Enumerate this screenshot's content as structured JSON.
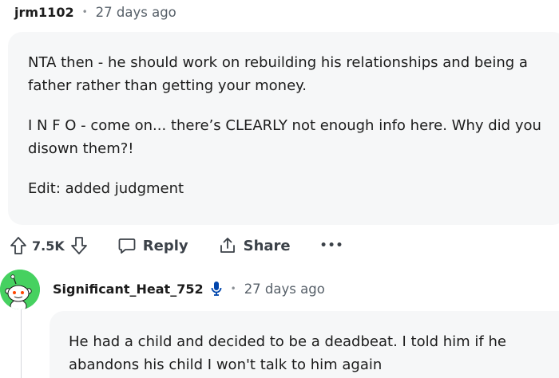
{
  "comment1": {
    "author": "jrm1102",
    "separator": "•",
    "time": "27 days ago",
    "paragraphs": [
      "NTA then - he should work on rebuilding his relationships and being a\nfather rather than getting your money.",
      "I N F O - come on... there’s CLEARLY not enough info here. Why did you\ndisown them?!",
      "Edit: added judgment"
    ],
    "actions": {
      "upvote_icon": "arrow-up-outline-icon",
      "vote_count": "7.5K",
      "downvote_icon": "arrow-down-outline-icon",
      "reply_label": "Reply",
      "share_label": "Share",
      "more_label": "•••"
    }
  },
  "comment2": {
    "author": "Significant_Heat_752",
    "badge_icon": "microphone-icon",
    "separator": "•",
    "time": "27 days ago",
    "paragraphs": [
      "He had a child and decided to be a deadbeat. I told him if he\nabandons his child I won't talk to him again"
    ]
  },
  "colors": {
    "bubble_bg": "#f6f7f8",
    "avatar_bg": "#46d160",
    "mic_badge": "#0045ac",
    "muted_text": "#576069"
  }
}
